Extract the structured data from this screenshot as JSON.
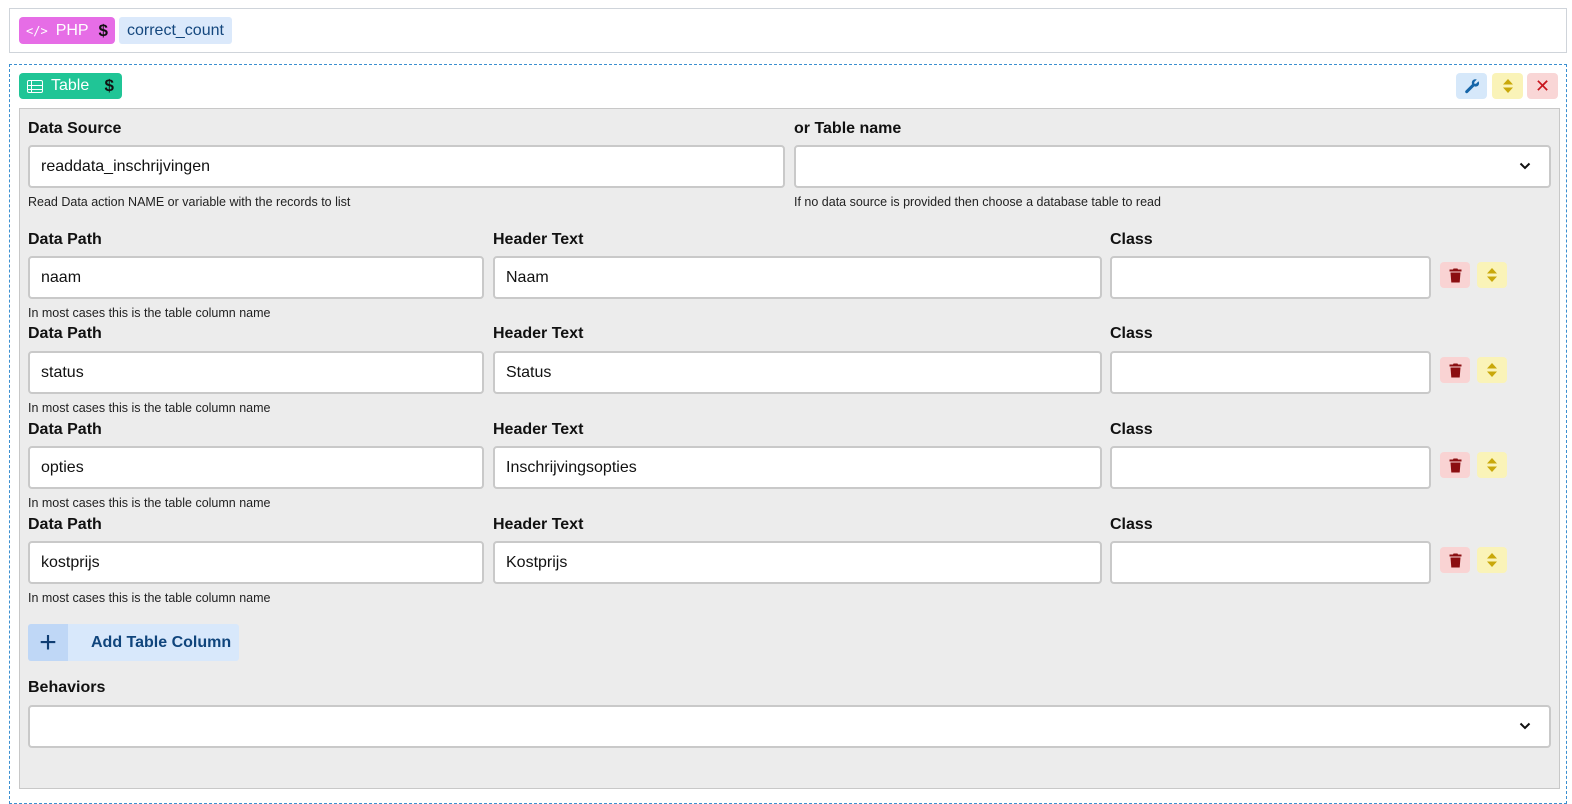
{
  "top": {
    "php_badge": {
      "code_symbol": "</>",
      "label": "PHP",
      "dollar": "$"
    },
    "variable_chip": "correct_count"
  },
  "component": {
    "badge": {
      "label": "Table",
      "dollar": "$"
    },
    "close_symbol": "✕",
    "data_source": {
      "label": "Data Source",
      "value": "readdata_inschrijvingen",
      "help": "Read Data action NAME or variable with the records to list"
    },
    "table_name": {
      "label": "or Table name",
      "value": "",
      "help": "If no data source is provided then choose a database table to read"
    },
    "columns": [
      {
        "data_path_label": "Data Path",
        "data_path": "naam",
        "header_label": "Header Text",
        "header": "Naam",
        "class_label": "Class",
        "class": "",
        "help": "In most cases this is the table column name"
      },
      {
        "data_path_label": "Data Path",
        "data_path": "status",
        "header_label": "Header Text",
        "header": "Status",
        "class_label": "Class",
        "class": "",
        "help": "In most cases this is the table column name"
      },
      {
        "data_path_label": "Data Path",
        "data_path": "opties",
        "header_label": "Header Text",
        "header": "Inschrijvingsopties",
        "class_label": "Class",
        "class": "",
        "help": "In most cases this is the table column name"
      },
      {
        "data_path_label": "Data Path",
        "data_path": "kostprijs",
        "header_label": "Header Text",
        "header": "Kostprijs",
        "class_label": "Class",
        "class": "",
        "help": "In most cases this is the table column name"
      }
    ],
    "add_column": {
      "plus": "+",
      "label": "Add Table Column"
    },
    "behaviors": {
      "label": "Behaviors",
      "value": ""
    }
  },
  "colors": {
    "php": "#e66de6",
    "table": "#20c596",
    "dashed_border": "#3b8fd0",
    "trash": "#8b0f12",
    "move": "#c9a80a"
  },
  "icons": [
    "code-icon",
    "dollar-icon",
    "table-icon",
    "wrench-icon",
    "sort-icon",
    "close-icon",
    "trash-icon",
    "chevron-down-icon",
    "plus-icon"
  ]
}
